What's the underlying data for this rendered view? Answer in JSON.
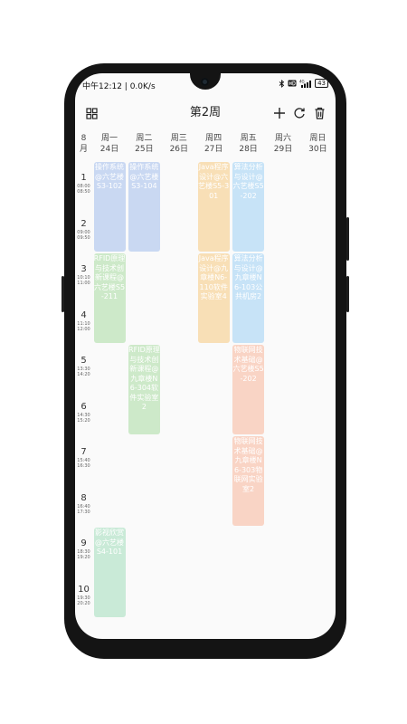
{
  "status": {
    "time": "中午12:12 | 0.0K/s",
    "icons": [
      "bluetooth-icon",
      "hd-icon",
      "signal-icon"
    ],
    "battery": "43"
  },
  "header": {
    "week_title": "第2周",
    "icons": [
      "grid-icon",
      "add-icon",
      "refresh-icon",
      "delete-icon"
    ]
  },
  "month": {
    "num": "8",
    "unit": "月"
  },
  "days": [
    {
      "name": "周一",
      "date": "24日"
    },
    {
      "name": "周二",
      "date": "25日"
    },
    {
      "name": "周三",
      "date": "26日"
    },
    {
      "name": "周四",
      "date": "27日"
    },
    {
      "name": "周五",
      "date": "28日"
    },
    {
      "name": "周六",
      "date": "29日"
    },
    {
      "name": "周日",
      "date": "30日"
    }
  ],
  "slots": [
    {
      "num": "1",
      "start": "08:00",
      "end": "08:50"
    },
    {
      "num": "2",
      "start": "09:00",
      "end": "09:50"
    },
    {
      "num": "3",
      "start": "10:10",
      "end": "11:00"
    },
    {
      "num": "4",
      "start": "11:10",
      "end": "12:00"
    },
    {
      "num": "5",
      "start": "13:30",
      "end": "14:20"
    },
    {
      "num": "6",
      "start": "14:30",
      "end": "15:20"
    },
    {
      "num": "7",
      "start": "15:40",
      "end": "16:30"
    },
    {
      "num": "8",
      "start": "16:40",
      "end": "17:30"
    },
    {
      "num": "9",
      "start": "18:30",
      "end": "19:20"
    },
    {
      "num": "10",
      "start": "19:30",
      "end": "20:20"
    }
  ],
  "colors": {
    "blue": "#c9d8f2",
    "green": "#cde9c9",
    "orange": "#f8dfb6",
    "sky": "#c7e3f7",
    "salmon": "#f9d4c5",
    "mint": "#c9ead7"
  },
  "courses": [
    {
      "day": 0,
      "start": 1,
      "span": 2,
      "color": "blue",
      "text": "操作系统@六艺楼S3-102"
    },
    {
      "day": 1,
      "start": 1,
      "span": 2,
      "color": "blue",
      "text": "操作系统@六艺楼S3-104"
    },
    {
      "day": 3,
      "start": 1,
      "span": 2,
      "color": "orange",
      "text": "Java程序设计@六艺楼S5-301"
    },
    {
      "day": 4,
      "start": 1,
      "span": 2,
      "color": "sky",
      "text": "算法分析与设计@六艺楼S5-202"
    },
    {
      "day": 0,
      "start": 3,
      "span": 2,
      "color": "green",
      "text": "RFID原理与技术创新课程@六艺楼S5-211"
    },
    {
      "day": 3,
      "start": 3,
      "span": 2,
      "color": "orange",
      "text": "Java程序设计@九章楼N6-110软件实验室4"
    },
    {
      "day": 4,
      "start": 3,
      "span": 2,
      "color": "sky",
      "text": "算法分析与设计@九章楼N6-103公共机房2"
    },
    {
      "day": 1,
      "start": 5,
      "span": 2,
      "color": "green",
      "text": "RFID原理与技术创新课程@九章楼N6-304软件实验室2"
    },
    {
      "day": 4,
      "start": 5,
      "span": 2,
      "color": "salmon",
      "text": "物联网技术基础@六艺楼S5-202"
    },
    {
      "day": 4,
      "start": 7,
      "span": 2,
      "color": "salmon",
      "text": "物联网技术基础@九章楼N6-303物联网实验室2"
    },
    {
      "day": 0,
      "start": 9,
      "span": 2,
      "color": "mint",
      "text": "影视欣赏@六艺楼S4-101"
    }
  ]
}
